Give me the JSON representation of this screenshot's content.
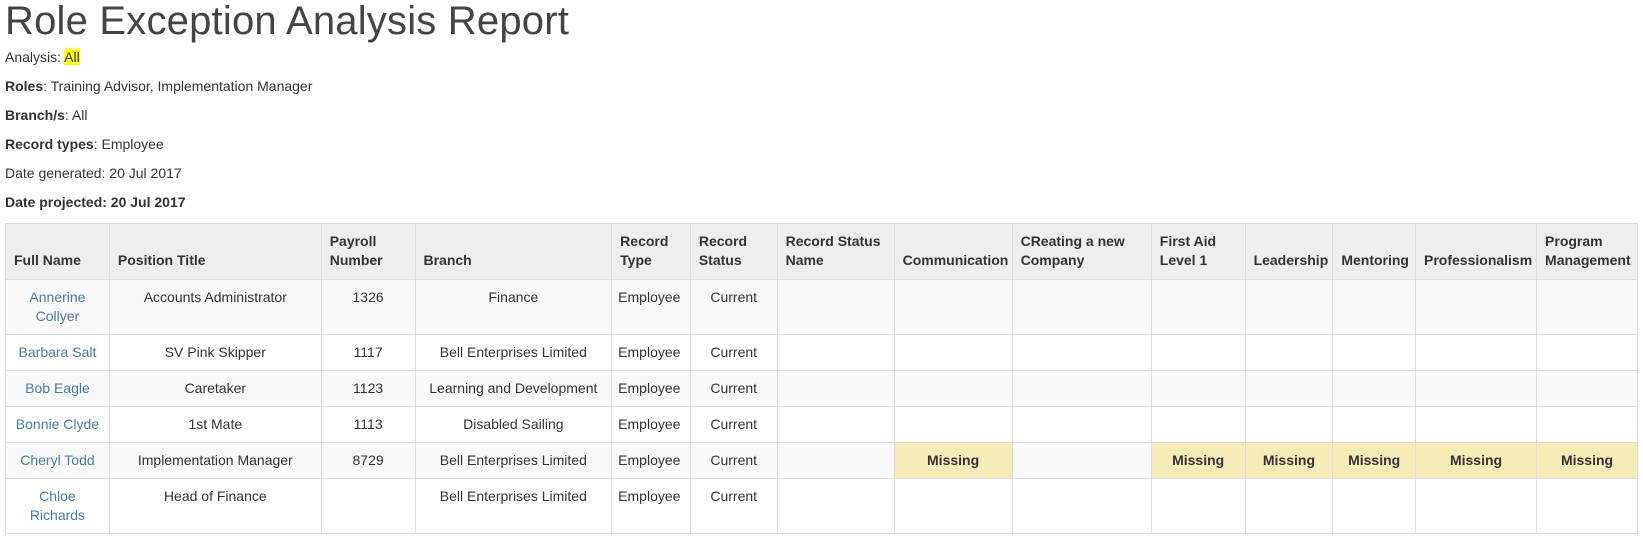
{
  "title": "Role Exception Analysis Report",
  "meta": {
    "analysis_label": "Analysis: ",
    "analysis_value": "All",
    "roles_label": "Roles",
    "roles_value": ": Training Advisor, Implementation Manager",
    "branches_label": "Branch/s",
    "branches_value": ": All",
    "record_types_label": "Record types",
    "record_types_value": ": Employee",
    "date_generated": "Date generated: 20 Jul 2017",
    "date_projected": "Date projected: 20 Jul 2017"
  },
  "table": {
    "headers": [
      "Full Name",
      "Position Title",
      "Payroll Number",
      "Branch",
      "Record Type",
      "Record Status",
      "Record Status Name",
      "Communication",
      "CReating a new Company",
      "First Aid Level 1",
      "Leadership",
      "Mentoring",
      "Professionalism",
      "Program Management"
    ],
    "rows": [
      [
        "Annerine Collyer",
        "Accounts Administrator",
        "1326",
        "Finance",
        "Employee",
        "Current",
        "",
        "",
        "",
        "",
        "",
        "",
        "",
        ""
      ],
      [
        "Barbara Salt",
        "SV Pink Skipper",
        "1117",
        "Bell Enterprises Limited",
        "Employee",
        "Current",
        "",
        "",
        "",
        "",
        "",
        "",
        "",
        ""
      ],
      [
        "Bob Eagle",
        "Caretaker",
        "1123",
        "Learning and Development",
        "Employee",
        "Current",
        "",
        "",
        "",
        "",
        "",
        "",
        "",
        ""
      ],
      [
        "Bonnie Clyde",
        "1st Mate",
        "1113",
        "Disabled Sailing",
        "Employee",
        "Current",
        "",
        "",
        "",
        "",
        "",
        "",
        "",
        ""
      ],
      [
        "Cheryl Todd",
        "Implementation Manager",
        "8729",
        "Bell Enterprises Limited",
        "Employee",
        "Current",
        "",
        "Missing",
        "",
        "Missing",
        "Missing",
        "Missing",
        "Missing",
        "Missing"
      ],
      [
        "Chloe Richards",
        "Head of Finance",
        "",
        "Bell Enterprises Limited",
        "Employee",
        "Current",
        "",
        "",
        "",
        "",
        "",
        "",
        "",
        ""
      ]
    ]
  },
  "colors": {
    "link": "#4a7a9e",
    "missing_bg": "#f6ecb8",
    "highlight": "#ffff00",
    "header_bg": "#eeeeee"
  }
}
